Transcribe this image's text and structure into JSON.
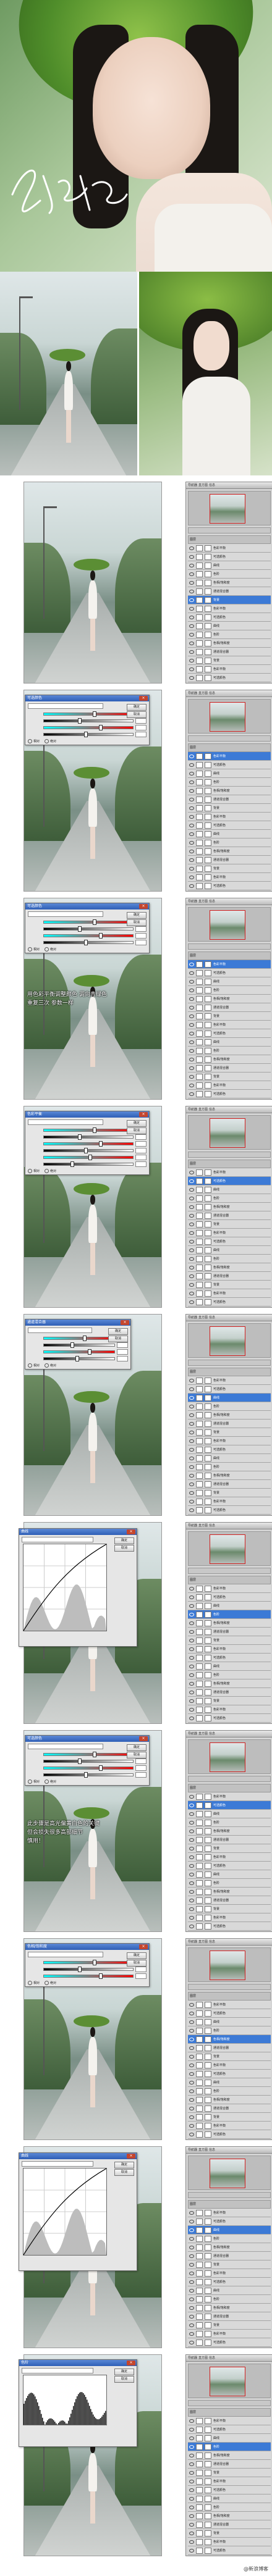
{
  "colors": {
    "layer_selected": "#3c7ad6",
    "dialog_title": "#2f5fb6",
    "nav_frame": "#d02020",
    "note_text": "#ffffff"
  },
  "header": {
    "signature_icon": "handwritten-signature-icon"
  },
  "ps_panel": {
    "tabs": [
      "导航器",
      "直方图",
      "信息"
    ],
    "layers_tab": "图层",
    "layer_names": [
      "色彩平衡",
      "可选颜色",
      "曲线",
      "色阶",
      "色相/饱和度",
      "通道混合器",
      "背景"
    ]
  },
  "steps": [
    {
      "id": "s1",
      "dialog": null,
      "note": ""
    },
    {
      "id": "s2",
      "dialog": {
        "type": "sliders",
        "title": "可选颜色",
        "sliders": 4
      },
      "note": ""
    },
    {
      "id": "s3",
      "dialog": {
        "type": "sliders",
        "title": "可选颜色",
        "sliders": 4
      },
      "note": "用色彩平衡调整颜色 调向青绿色\n重复三次 参数一样"
    },
    {
      "id": "s4",
      "dialog": {
        "type": "sliders",
        "title": "色彩平衡",
        "sliders": 6
      },
      "note": ""
    },
    {
      "id": "s5",
      "dialog": {
        "type": "mixer",
        "title": "通道混合器",
        "sliders": 4
      },
      "note": ""
    },
    {
      "id": "s6",
      "dialog": {
        "type": "curves",
        "title": "曲线"
      },
      "note": ""
    },
    {
      "id": "s7",
      "dialog": {
        "type": "sliders",
        "title": "可选颜色",
        "sliders": 4
      },
      "note": "此步骤是高光偏黄白色的关键\n但会损失很多高部细节\n慎用！"
    },
    {
      "id": "s8",
      "dialog": {
        "type": "sliders",
        "title": "色相/饱和度",
        "sliders": 3
      },
      "note": ""
    },
    {
      "id": "s9",
      "dialog": {
        "type": "curves",
        "title": "曲线"
      },
      "note": ""
    },
    {
      "id": "s10",
      "dialog": {
        "type": "levels",
        "title": "色阶"
      },
      "note": ""
    }
  ],
  "dialog_buttons": {
    "ok": "确定",
    "cancel": "取消"
  },
  "dialog_options": {
    "relative": "相对",
    "absolute": "绝对",
    "preview": "预览"
  },
  "footer": {
    "watermark": "@新浪博客"
  }
}
